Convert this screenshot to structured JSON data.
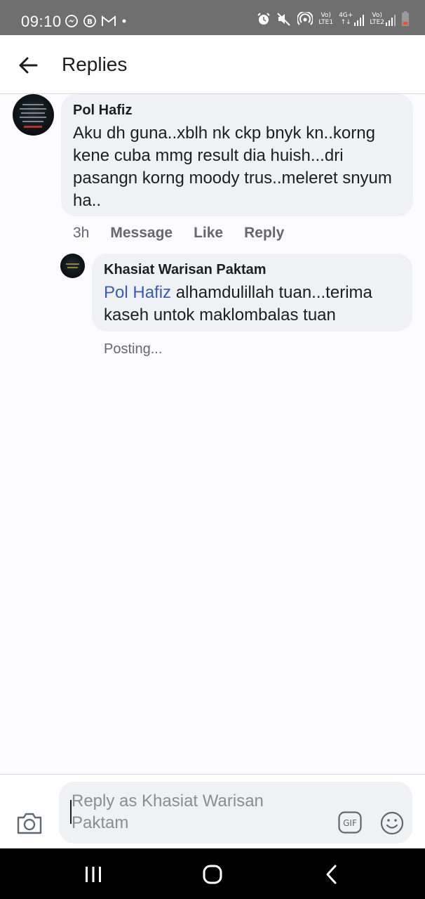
{
  "status_bar": {
    "time": "09:10",
    "left_icons": [
      "messenger-icon",
      "b-circle-icon",
      "gmail-icon",
      "dot-icon"
    ],
    "right_icons": [
      "alarm-icon",
      "mute-icon",
      "hotspot-icon",
      "volte-lte1-icon",
      "4g-signal-icon",
      "volte-lte2-icon",
      "battery-icon"
    ],
    "volte1_top": "Vo)",
    "volte1_bottom": "LTE1",
    "net_type": "4G+",
    "volte2_top": "Vo)",
    "volte2_bottom": "LTE2"
  },
  "header": {
    "title": "Replies"
  },
  "comment": {
    "author": "Pol Hafiz",
    "text": "Aku dh guna..xblh nk ckp bnyk kn..korng kene cuba mmg result dia huish...dri pasangn korng moody trus..meleret snyum ha..",
    "time": "3h",
    "actions": {
      "message": "Message",
      "like": "Like",
      "reply": "Reply"
    }
  },
  "reply": {
    "author": "Khasiat Warisan Paktam",
    "mention": "Pol Hafiz",
    "text": " alhamdulillah tuan...terima kaseh untok maklombalas tuan",
    "status": "Posting..."
  },
  "composer": {
    "placeholder": "Reply as Khasiat Warisan Paktam",
    "gif_label": "GIF"
  },
  "colors": {
    "status_bar": "#6f6f70",
    "bubble": "#f0f1f5",
    "mention": "#3b5cad",
    "muted": "#65676b"
  }
}
